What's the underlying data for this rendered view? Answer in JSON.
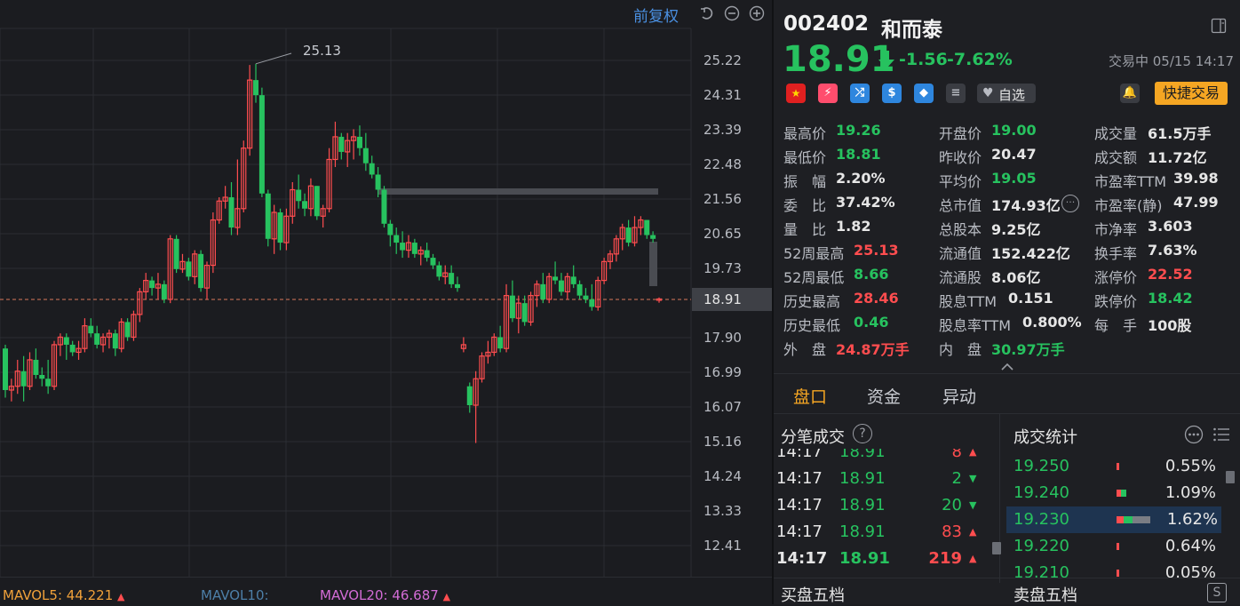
{
  "chart": {
    "fuquan_label": "前复权",
    "y_ticks": [
      "25.22",
      "24.31",
      "23.39",
      "22.48",
      "21.56",
      "20.65",
      "19.73",
      "18.91",
      "17.90",
      "16.99",
      "16.07",
      "15.16",
      "14.24",
      "13.33",
      "12.41"
    ],
    "max_label": "25.13",
    "current_price_tag": "18.91",
    "mavol5": "MAVOL5: 44.221",
    "mavol10": "MAVOL10:",
    "mavol20": "MAVOL20: 46.687"
  },
  "chart_data": {
    "type": "candlestick",
    "colors": {
      "up": "#ff4d4f",
      "down": "#27c25f"
    },
    "ohlc": [
      [
        17.6,
        17.7,
        16.3,
        16.5
      ],
      [
        16.5,
        16.8,
        16.2,
        16.6
      ],
      [
        16.6,
        17.3,
        16.4,
        17.0
      ],
      [
        17.0,
        17.4,
        16.2,
        16.6
      ],
      [
        16.6,
        17.5,
        16.5,
        17.3
      ],
      [
        17.3,
        17.6,
        16.8,
        16.9
      ],
      [
        16.9,
        17.1,
        16.6,
        16.8
      ],
      [
        16.8,
        17.3,
        16.4,
        16.6
      ],
      [
        16.6,
        17.8,
        16.5,
        17.7
      ],
      [
        17.7,
        18.0,
        17.4,
        17.9
      ],
      [
        17.9,
        18.0,
        17.3,
        17.7
      ],
      [
        17.7,
        17.8,
        17.4,
        17.5
      ],
      [
        17.5,
        17.8,
        17.3,
        17.6
      ],
      [
        17.6,
        18.4,
        17.5,
        18.2
      ],
      [
        18.2,
        18.4,
        17.9,
        18.0
      ],
      [
        18.0,
        18.2,
        17.6,
        17.7
      ],
      [
        17.7,
        18.0,
        17.5,
        17.9
      ],
      [
        17.9,
        18.1,
        17.6,
        18.0
      ],
      [
        18.0,
        18.1,
        17.4,
        17.6
      ],
      [
        17.6,
        18.4,
        17.5,
        18.3
      ],
      [
        18.3,
        18.4,
        17.8,
        17.9
      ],
      [
        17.9,
        18.6,
        17.8,
        18.5
      ],
      [
        18.5,
        19.2,
        18.3,
        19.1
      ],
      [
        19.1,
        19.6,
        18.9,
        19.4
      ],
      [
        19.4,
        19.5,
        19.0,
        19.2
      ],
      [
        19.2,
        19.6,
        18.9,
        19.3
      ],
      [
        19.3,
        19.4,
        18.8,
        18.9
      ],
      [
        18.9,
        20.6,
        18.8,
        20.5
      ],
      [
        20.5,
        20.6,
        19.6,
        19.7
      ],
      [
        19.7,
        20.1,
        19.6,
        19.9
      ],
      [
        19.9,
        20.0,
        19.4,
        19.5
      ],
      [
        19.5,
        20.2,
        19.3,
        20.1
      ],
      [
        20.1,
        20.2,
        19.1,
        19.2
      ],
      [
        19.2,
        19.9,
        18.9,
        19.8
      ],
      [
        19.8,
        21.2,
        19.6,
        21.0
      ],
      [
        21.0,
        21.6,
        20.9,
        21.5
      ],
      [
        21.5,
        21.9,
        21.3,
        21.6
      ],
      [
        21.6,
        22.0,
        20.6,
        20.8
      ],
      [
        20.8,
        22.6,
        20.6,
        21.3
      ],
      [
        21.3,
        23.1,
        21.2,
        22.9
      ],
      [
        22.9,
        25.1,
        22.7,
        24.7
      ],
      [
        24.7,
        25.13,
        24.1,
        24.3
      ],
      [
        24.3,
        24.5,
        21.6,
        21.7
      ],
      [
        21.7,
        21.8,
        20.3,
        20.5
      ],
      [
        20.5,
        21.4,
        20.1,
        21.2
      ],
      [
        21.2,
        21.3,
        20.2,
        20.4
      ],
      [
        20.4,
        21.3,
        20.2,
        21.1
      ],
      [
        21.1,
        22.0,
        20.9,
        21.8
      ],
      [
        21.8,
        22.2,
        21.3,
        21.5
      ],
      [
        21.5,
        21.7,
        21.1,
        21.3
      ],
      [
        21.3,
        22.1,
        21.1,
        21.9
      ],
      [
        21.9,
        21.9,
        21.0,
        21.1
      ],
      [
        21.1,
        21.4,
        20.8,
        21.3
      ],
      [
        21.3,
        22.9,
        21.2,
        22.6
      ],
      [
        22.6,
        23.6,
        22.4,
        23.2
      ],
      [
        23.2,
        23.3,
        22.6,
        22.8
      ],
      [
        22.8,
        23.3,
        22.4,
        23.1
      ],
      [
        23.1,
        23.4,
        22.6,
        23.2
      ],
      [
        23.2,
        23.5,
        22.7,
        22.9
      ],
      [
        22.9,
        23.3,
        22.3,
        22.5
      ],
      [
        22.5,
        22.7,
        22.1,
        22.2
      ],
      [
        22.2,
        22.4,
        21.6,
        21.8
      ],
      [
        21.8,
        21.9,
        20.8,
        20.9
      ],
      [
        20.9,
        21.0,
        20.3,
        20.6
      ],
      [
        20.6,
        20.8,
        20.1,
        20.4
      ],
      [
        20.4,
        20.7,
        20.0,
        20.2
      ],
      [
        20.2,
        20.6,
        20.0,
        20.4
      ],
      [
        20.4,
        20.5,
        20.0,
        20.1
      ],
      [
        20.1,
        20.3,
        19.8,
        20.2
      ],
      [
        20.2,
        20.4,
        19.9,
        20.0
      ],
      [
        20.0,
        20.1,
        19.7,
        19.8
      ],
      [
        19.8,
        19.9,
        19.4,
        19.5
      ],
      [
        19.5,
        19.8,
        19.3,
        19.6
      ],
      [
        19.6,
        19.8,
        19.2,
        19.3
      ],
      [
        19.3,
        19.5,
        19.1,
        19.2
      ],
      [
        17.6,
        17.9,
        17.5,
        17.7
      ],
      [
        16.6,
        16.7,
        15.9,
        16.1
      ],
      [
        16.1,
        17.0,
        15.1,
        16.8
      ],
      [
        16.8,
        17.5,
        16.7,
        17.4
      ],
      [
        17.4,
        17.8,
        17.2,
        17.5
      ],
      [
        17.5,
        18.0,
        17.4,
        17.9
      ],
      [
        17.9,
        18.2,
        17.5,
        17.6
      ],
      [
        17.6,
        19.3,
        17.5,
        19.0
      ],
      [
        19.0,
        19.4,
        18.3,
        18.4
      ],
      [
        18.4,
        19.0,
        18.0,
        18.8
      ],
      [
        18.8,
        19.0,
        18.2,
        18.3
      ],
      [
        18.3,
        19.1,
        18.2,
        19.0
      ],
      [
        19.0,
        19.4,
        18.7,
        19.3
      ],
      [
        19.3,
        19.6,
        18.8,
        18.9
      ],
      [
        18.9,
        19.6,
        18.8,
        19.5
      ],
      [
        19.5,
        19.9,
        19.3,
        19.4
      ],
      [
        19.4,
        19.6,
        19.0,
        19.1
      ],
      [
        19.1,
        19.6,
        18.9,
        19.5
      ],
      [
        19.5,
        19.8,
        19.2,
        19.3
      ],
      [
        19.3,
        19.4,
        18.9,
        19.0
      ],
      [
        19.0,
        19.2,
        18.8,
        18.9
      ],
      [
        18.9,
        19.3,
        18.6,
        18.7
      ],
      [
        18.7,
        19.5,
        18.6,
        19.4
      ],
      [
        19.4,
        20.0,
        19.3,
        19.9
      ],
      [
        19.9,
        20.2,
        19.7,
        20.1
      ],
      [
        20.1,
        20.6,
        19.9,
        20.5
      ],
      [
        20.5,
        20.9,
        20.2,
        20.8
      ],
      [
        20.8,
        21.0,
        20.3,
        20.4
      ],
      [
        20.4,
        21.1,
        20.3,
        20.8
      ],
      [
        20.8,
        21.1,
        20.6,
        21.0
      ],
      [
        21.0,
        21.0,
        20.5,
        20.6
      ],
      [
        20.6,
        20.7,
        20.4,
        20.5
      ],
      [
        18.9,
        18.95,
        18.81,
        18.91
      ]
    ],
    "last_close": 18.91
  },
  "stock": {
    "code": "002402",
    "name": "和而泰",
    "price": "18.91",
    "change": "-1.56",
    "change_pct": "-7.62%",
    "status": "交易中 05/15 14:17",
    "watch_label": "自选",
    "quick_trade_label": "快捷交易"
  },
  "quote": {
    "col1": [
      {
        "label": "最高价",
        "value": "19.26",
        "color": "green"
      },
      {
        "label": "最低价",
        "value": "18.81",
        "color": "green"
      },
      {
        "label": "振　幅",
        "value": "2.20%",
        "color": "white"
      },
      {
        "label": "委　比",
        "value": "37.42%",
        "color": "white"
      },
      {
        "label": "量　比",
        "value": "1.82",
        "color": "white"
      },
      {
        "label": "52周最高",
        "value": "25.13",
        "color": "red"
      },
      {
        "label": "52周最低",
        "value": "8.66",
        "color": "green"
      },
      {
        "label": "历史最高",
        "value": "28.46",
        "color": "red"
      },
      {
        "label": "历史最低",
        "value": "0.46",
        "color": "green"
      },
      {
        "label": "外　盘",
        "value": "24.87万手",
        "color": "red"
      }
    ],
    "col2": [
      {
        "label": "开盘价",
        "value": "19.00",
        "color": "green"
      },
      {
        "label": "昨收价",
        "value": "20.47",
        "color": "white"
      },
      {
        "label": "平均价",
        "value": "19.05",
        "color": "green"
      },
      {
        "label": "总市值",
        "value": "174.93亿",
        "color": "white"
      },
      {
        "label": "总股本",
        "value": "9.25亿",
        "color": "white"
      },
      {
        "label": "流通值",
        "value": "152.422亿",
        "color": "white"
      },
      {
        "label": "流通股",
        "value": "8.06亿",
        "color": "white"
      },
      {
        "label": "股息TTM",
        "value": "0.151",
        "color": "white"
      },
      {
        "label": "股息率TTM",
        "value": "0.800%",
        "color": "white"
      },
      {
        "label": "内　盘",
        "value": "30.97万手",
        "color": "green"
      }
    ],
    "col3": [
      {
        "label": "成交量",
        "value": "61.5万手",
        "color": "white"
      },
      {
        "label": "成交额",
        "value": "11.72亿",
        "color": "white"
      },
      {
        "label": "市盈率TTM",
        "value": "39.98",
        "color": "white"
      },
      {
        "label": "市盈率(静)",
        "value": "47.99",
        "color": "white"
      },
      {
        "label": "市净率",
        "value": "3.603",
        "color": "white"
      },
      {
        "label": "换手率",
        "value": "7.63%",
        "color": "white"
      },
      {
        "label": "涨停价",
        "value": "22.52",
        "color": "red"
      },
      {
        "label": "跌停价",
        "value": "18.42",
        "color": "green"
      },
      {
        "label": "每　手",
        "value": "100股",
        "color": "white"
      }
    ]
  },
  "tabs": [
    "盘口",
    "资金",
    "异动"
  ],
  "ticks": {
    "title": "分笔成交",
    "help_icon": "?",
    "rows": [
      {
        "time": "14:17",
        "price": "18.91",
        "vol": "8",
        "dir": "up"
      },
      {
        "time": "14:17",
        "price": "18.91",
        "vol": "2",
        "dir": "down"
      },
      {
        "time": "14:17",
        "price": "18.91",
        "vol": "20",
        "dir": "down"
      },
      {
        "time": "14:17",
        "price": "18.91",
        "vol": "83",
        "dir": "up"
      },
      {
        "time": "14:17",
        "price": "18.91",
        "vol": "219",
        "dir": "up"
      }
    ]
  },
  "stats": {
    "title": "成交统计",
    "rows": [
      {
        "price": "19.250",
        "pct": "0.55%",
        "bar_fraction": 0.25
      },
      {
        "price": "19.240",
        "pct": "1.09%",
        "bar_fraction": 0.5
      },
      {
        "price": "19.230",
        "pct": "1.62%",
        "bar_fraction": 0.95
      },
      {
        "price": "19.220",
        "pct": "0.64%",
        "bar_fraction": 0.3
      },
      {
        "price": "19.210",
        "pct": "0.05%",
        "bar_fraction": 0.05
      }
    ]
  },
  "bottom": {
    "buy5": "买盘五档",
    "sell5": "卖盘五档",
    "s_icon": "S"
  }
}
